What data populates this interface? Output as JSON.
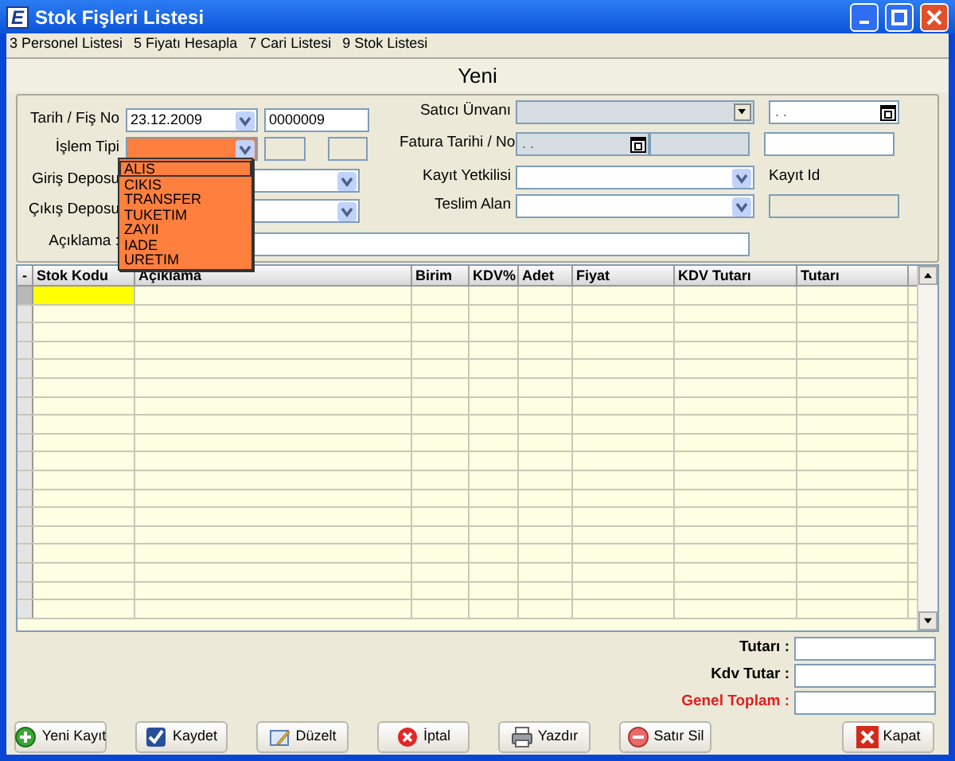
{
  "window": {
    "icon_letter": "E",
    "title": "Stok Fişleri Listesi"
  },
  "menu": [
    "3 Personel Listesi",
    "5 Fiyatı Hesapla",
    "7 Cari Listesi",
    "9 Stok Listesi"
  ],
  "header": "Yeni",
  "left_form": {
    "tarih_label": "Tarih / Fiş No",
    "tarih": "23.12.2009",
    "fis_no": "0000009",
    "islem_tipi_label": "İşlem Tipi",
    "giris_deposu_label": "Giriş Deposu",
    "cikis_deposu_label": "Çıkış Deposu",
    "aciklama_label": "Açıklama :"
  },
  "right_form": {
    "satici_label": "Satıcı Ünvanı",
    "satici_date": ". .",
    "fatura_label": "Fatura Tarihi / No",
    "fatura_date": ". .",
    "kayit_yetkilisi_label": "Kayıt Yetkilisi",
    "kayit_id_label": "Kayıt Id",
    "teslim_alan_label": "Teslim Alan"
  },
  "islem_tipi_dropdown": {
    "expanded": true,
    "options": [
      {
        "label": "ALIS",
        "selected": true
      },
      {
        "label": "CIKIS",
        "selected": false
      },
      {
        "label": "TRANSFER",
        "selected": false
      },
      {
        "label": "TUKETIM",
        "selected": false
      },
      {
        "label": "ZAYII",
        "selected": false
      },
      {
        "label": "IADE",
        "selected": false
      },
      {
        "label": "URETIM",
        "selected": false
      }
    ]
  },
  "grid": {
    "corner": "-",
    "columns": [
      "Stok Kodu",
      "Açıklama",
      "Birim",
      "KDV%",
      "Adet",
      "Fiyat",
      "KDV Tutarı",
      "Tutarı"
    ],
    "rows": [
      {
        "selected": true
      },
      {
        "selected": false
      },
      {
        "selected": false
      },
      {
        "selected": false
      },
      {
        "selected": false
      },
      {
        "selected": false
      },
      {
        "selected": false
      },
      {
        "selected": false
      },
      {
        "selected": false
      },
      {
        "selected": false
      },
      {
        "selected": false
      },
      {
        "selected": false
      },
      {
        "selected": false
      },
      {
        "selected": false
      },
      {
        "selected": false
      },
      {
        "selected": false
      },
      {
        "selected": false
      },
      {
        "selected": false
      }
    ]
  },
  "totals": [
    {
      "label": "Tutarı :",
      "kind": "normal"
    },
    {
      "label": "Kdv Tutar :",
      "kind": "normal"
    },
    {
      "label": "Genel Toplam :",
      "kind": "grand"
    }
  ],
  "buttons": [
    {
      "label": "Yeni Kayıt",
      "kind": "add"
    },
    {
      "label": "Kaydet",
      "kind": "save"
    },
    {
      "label": "Düzelt",
      "kind": "edit"
    },
    {
      "label": "İptal",
      "kind": "cancel"
    },
    {
      "label": "Yazdır",
      "kind": "print"
    },
    {
      "label": "Satır Sil",
      "kind": "delete"
    },
    {
      "label": "Kapat",
      "kind": "close"
    }
  ]
}
